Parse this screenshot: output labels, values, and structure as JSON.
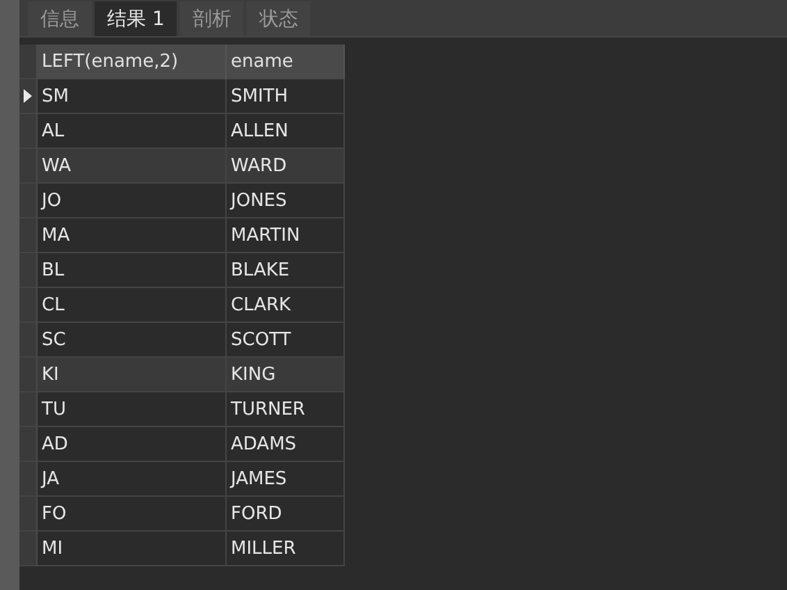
{
  "tabs": [
    {
      "label": "信息",
      "selected": false
    },
    {
      "label": "结果 1",
      "selected": true
    },
    {
      "label": "剖析",
      "selected": false
    },
    {
      "label": "状态",
      "selected": false
    }
  ],
  "table": {
    "columns": [
      "LEFT(ename,2)",
      "ename"
    ],
    "rows": [
      {
        "cells": [
          "SM",
          "SMITH"
        ],
        "selected": true,
        "highlighted": false
      },
      {
        "cells": [
          "AL",
          "ALLEN"
        ],
        "selected": false,
        "highlighted": false
      },
      {
        "cells": [
          "WA",
          "WARD"
        ],
        "selected": false,
        "highlighted": true
      },
      {
        "cells": [
          "JO",
          "JONES"
        ],
        "selected": false,
        "highlighted": false
      },
      {
        "cells": [
          "MA",
          "MARTIN"
        ],
        "selected": false,
        "highlighted": false
      },
      {
        "cells": [
          "BL",
          "BLAKE"
        ],
        "selected": false,
        "highlighted": false
      },
      {
        "cells": [
          "CL",
          "CLARK"
        ],
        "selected": false,
        "highlighted": false
      },
      {
        "cells": [
          "SC",
          "SCOTT"
        ],
        "selected": false,
        "highlighted": false
      },
      {
        "cells": [
          "KI",
          "KING"
        ],
        "selected": false,
        "highlighted": true
      },
      {
        "cells": [
          "TU",
          "TURNER"
        ],
        "selected": false,
        "highlighted": false
      },
      {
        "cells": [
          "AD",
          "ADAMS"
        ],
        "selected": false,
        "highlighted": false
      },
      {
        "cells": [
          "JA",
          "JAMES"
        ],
        "selected": false,
        "highlighted": false
      },
      {
        "cells": [
          "FO",
          "FORD"
        ],
        "selected": false,
        "highlighted": false
      },
      {
        "cells": [
          "MI",
          "MILLER"
        ],
        "selected": false,
        "highlighted": false
      }
    ]
  }
}
